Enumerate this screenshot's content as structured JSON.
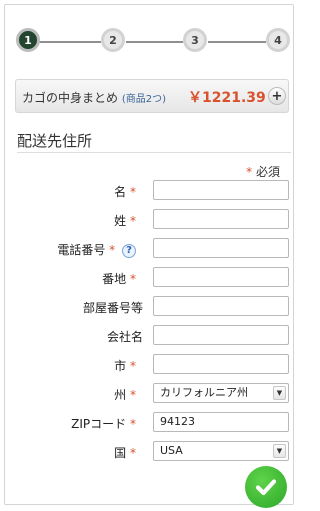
{
  "stepper": {
    "steps": [
      "1",
      "2",
      "3",
      "4"
    ],
    "current_step": 1
  },
  "cart": {
    "title": "カゴの中身まとめ",
    "count": "(商品2つ)",
    "price": "￥1221.39",
    "expand": "+"
  },
  "section_title": "配送先住所",
  "required": {
    "marker": "*",
    "label": "必須"
  },
  "fields": [
    {
      "label": "名",
      "required": true,
      "value": ""
    },
    {
      "label": "姓",
      "required": true,
      "value": ""
    },
    {
      "label": "電話番号",
      "required": true,
      "value": "",
      "help": "?"
    },
    {
      "label": "番地",
      "required": true,
      "value": ""
    },
    {
      "label": "部屋番号等",
      "required": false,
      "value": ""
    },
    {
      "label": "会社名",
      "required": false,
      "value": ""
    },
    {
      "label": "市",
      "required": true,
      "value": ""
    },
    {
      "label": "州",
      "required": true,
      "value": "カリフォルニア州",
      "type": "select"
    },
    {
      "label": "ZIPコード",
      "required": true,
      "value": "94123"
    },
    {
      "label": "国",
      "required": true,
      "value": "USA",
      "type": "select"
    }
  ],
  "colors": {
    "accent": "#d8522e",
    "active_step": "#24452f",
    "submit": "#36b22f",
    "link": "#39639a"
  },
  "icons": {
    "submit": "check-icon",
    "help": "question-icon",
    "dropdown": "chevron-down-icon"
  }
}
